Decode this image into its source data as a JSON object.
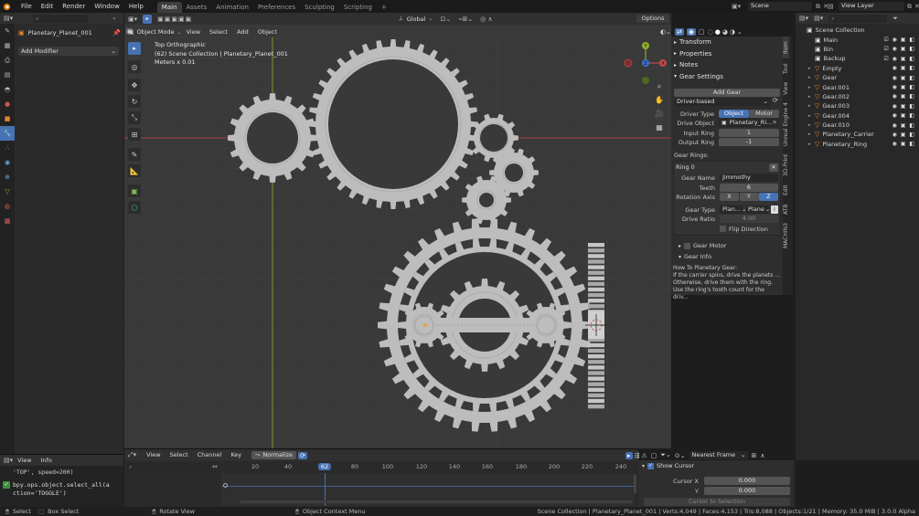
{
  "topbar": {
    "menus": [
      "File",
      "Edit",
      "Render",
      "Window",
      "Help"
    ],
    "workspaces": [
      "Main",
      "Assets",
      "Animation",
      "Preferences",
      "Sculpting",
      "Scripting"
    ],
    "active_workspace": "Main",
    "add_tab": "+",
    "scene": "Scene",
    "view_layer": "View Layer"
  },
  "properties_panel": {
    "object_name": "Planetary_Planet_001",
    "add_modifier": "Add Modifier"
  },
  "console": {
    "menus": [
      "View",
      "Info"
    ],
    "line1": "'TOP', speed=200)",
    "line2": "bpy.ops.object.select_all(a",
    "line3": "ction='TOGGLE')"
  },
  "viewport": {
    "mode": "Object Mode",
    "menus": [
      "View",
      "Select",
      "Add",
      "Object"
    ],
    "transform_orientation": "Global",
    "options": "Options",
    "info_line1": "Top Orthographic",
    "info_line2": "(62) Scene Collection | Planetary_Planet_001",
    "info_line3": "Meters x 0.01",
    "gizmo_axes": [
      "Y",
      "X",
      "Z"
    ]
  },
  "sidebar": {
    "tabs": [
      "Item",
      "Tool",
      "View",
      "Unreal Engine 4",
      "3D-Print",
      "Edit",
      "ATB",
      "MACHIN3"
    ],
    "transform": "Transform",
    "properties": "Properties",
    "notes": "Notes",
    "gear_settings": "Gear Settings",
    "add_gear": "Add Gear",
    "driver_mode": "Driver-based",
    "driver_type_label": "Driver Type",
    "driver_type_object": "Object",
    "driver_type_motor": "Motor",
    "drive_object_label": "Drive Object",
    "drive_object_value": "Planetary_Ri...",
    "input_ring_label": "Input Ring",
    "input_ring_value": "1",
    "output_ring_label": "Output Ring",
    "output_ring_value": "-1",
    "gear_rings_label": "Gear Rings:",
    "ring_name": "Ring 0",
    "gear_name_label": "Gear Name",
    "gear_name_value": "Jimmothy",
    "teeth_label": "Teeth",
    "teeth_value": "6",
    "rotation_axis_label": "Rotation Axis",
    "axis_x": "X",
    "axis_y": "Y",
    "axis_z": "Z",
    "gear_type_label": "Gear Type",
    "gear_type_value": "Plan...",
    "gear_type_value2": "Plane",
    "drive_ratio_label": "Drive Ratio",
    "drive_ratio_value": "4.00",
    "flip_direction": "Flip Direction",
    "gear_motor": "Gear Motor",
    "gear_info": "Gear Info",
    "info_title": "How To Planetary Gear:",
    "info_line1": "If the carrier spins, drive the planets ...",
    "info_line2": "Otherwise, drive them with the ring.",
    "info_line3": "Use the ring's tooth count for the driv..."
  },
  "outliner": {
    "root": "Scene Collection",
    "items": [
      "Main",
      "Bin",
      "Backup",
      "Empty",
      "Gear",
      "Gear.001",
      "Gear.002",
      "Gear.003",
      "Gear.004",
      "Gear.010",
      "Planetary_Carrier",
      "Planetary_Ring"
    ]
  },
  "timeline": {
    "menus": [
      "View",
      "Select",
      "Channel",
      "Key"
    ],
    "normalize": "Normalize",
    "frame_labels": [
      "20",
      "40",
      "62",
      "80",
      "100",
      "120",
      "140",
      "160",
      "180",
      "200",
      "220",
      "240"
    ],
    "current_frame": "62",
    "pivot": "Nearest Frame",
    "show_cursor": "Show Cursor",
    "cursor_x_label": "Cursor X",
    "cursor_x_value": "0.000",
    "cursor_y_label": "Y",
    "cursor_y_value": "0.000",
    "cursor_to_selection": "Cursor to Selection"
  },
  "statusbar": {
    "select": "Select",
    "box_select": "Box Select",
    "rotate_view": "Rotate View",
    "context_menu": "Object Context Menu",
    "stats": "Scene Collection | Planetary_Planet_001 | Verts:4,049 | Faces:4,153 | Tris:8,088 | Objects:1/21 | Memory: 35.0 MiB | 3.0.0 Alpha"
  },
  "colors": {
    "accent": "#4772b3",
    "gear": "#bdbdbd",
    "x_axis": "#c44a4a",
    "y_axis": "#8eb02c"
  }
}
